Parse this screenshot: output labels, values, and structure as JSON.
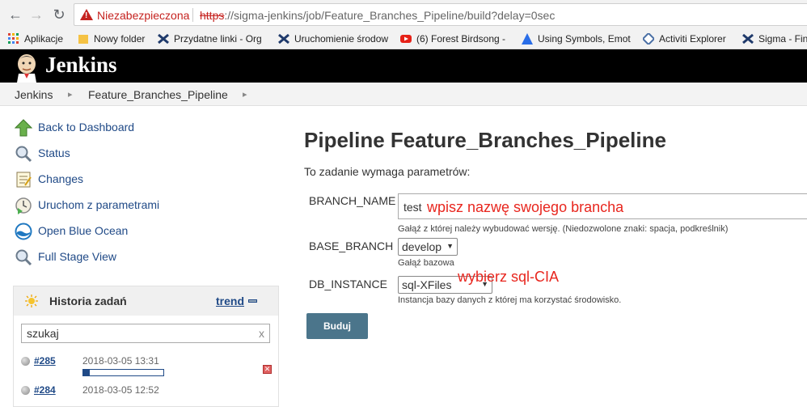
{
  "browser": {
    "security_label": "Niezabezpieczona",
    "url_protocol": "https",
    "url_rest": "://sigma-jenkins/job/Feature_Branches_Pipeline/build?delay=0sec"
  },
  "bookmarks": [
    {
      "label": "Aplikacje",
      "icon": "apps-grid-icon"
    },
    {
      "label": "Nowy folder",
      "icon": "folder-icon"
    },
    {
      "label": "Przydatne linki - Org",
      "icon": "confluence-icon"
    },
    {
      "label": "Uruchomienie środow",
      "icon": "confluence-icon"
    },
    {
      "label": "(6) Forest Birdsong -",
      "icon": "youtube-icon"
    },
    {
      "label": "Using Symbols, Emot",
      "icon": "triangle-icon"
    },
    {
      "label": "Activiti Explorer",
      "icon": "diamond-icon"
    },
    {
      "label": "Sigma - Fin",
      "icon": "confluence-icon"
    }
  ],
  "header": {
    "title": "Jenkins"
  },
  "breadcrumb": {
    "root": "Jenkins",
    "job": "Feature_Branches_Pipeline"
  },
  "sidebar": {
    "tasks": [
      {
        "label": "Back to Dashboard",
        "icon": "up-arrow-icon"
      },
      {
        "label": "Status",
        "icon": "magnifier-icon"
      },
      {
        "label": "Changes",
        "icon": "notepad-icon"
      },
      {
        "label": "Uruchom z parametrami",
        "icon": "clock-play-icon"
      },
      {
        "label": "Open Blue Ocean",
        "icon": "blue-ocean-icon"
      },
      {
        "label": "Full Stage View",
        "icon": "magnifier-icon"
      }
    ],
    "history": {
      "title": "Historia zadań",
      "trend_label": "trend",
      "search_value": "szukaj",
      "search_clear": "x",
      "builds": [
        {
          "number": "#285",
          "date": "2018-03-05 13:31",
          "progress": 0.08,
          "running": true
        },
        {
          "number": "#284",
          "date": "2018-03-05 12:52",
          "running": false
        }
      ]
    }
  },
  "main": {
    "title": "Pipeline Feature_Branches_Pipeline",
    "note": "To zadanie wymaga parametrów:",
    "params": {
      "branch_name": {
        "label": "BRANCH_NAME",
        "value": "test",
        "description": "Gałąź z której należy wybudować wersję. (Niedozwolone znaki: spacja, podkreślnik)"
      },
      "base_branch": {
        "label": "BASE_BRANCH",
        "value": "develop",
        "description": "Gałąź bazowa"
      },
      "db_instance": {
        "label": "DB_INSTANCE",
        "value": "sql-XFiles",
        "description": "Instancja bazy danych z której ma korzystać środowisko."
      }
    },
    "annotations": {
      "branch_hint": "wpisz nazwę swojego brancha",
      "db_hint": "wybierz sql-CIA"
    },
    "build_button": "Buduj"
  },
  "colors": {
    "link": "#204a87",
    "annotation": "#e8261e",
    "button": "#4b758b",
    "header_bg": "#000000"
  }
}
